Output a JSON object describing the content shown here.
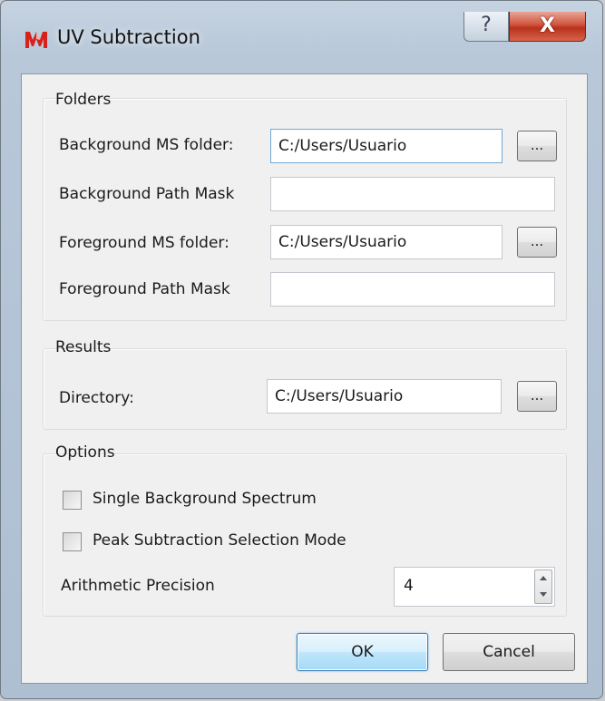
{
  "window": {
    "title": "UV Subtraction",
    "app_icon": "m-logo-icon",
    "help_label": "?",
    "close_label": "X"
  },
  "folders": {
    "title": "Folders",
    "background_ms_label": "Background MS folder:",
    "background_ms_value": "C:/Users/Usuario",
    "background_mask_label": "Background Path Mask",
    "background_mask_value": "",
    "foreground_ms_label": "Foreground MS folder:",
    "foreground_ms_value": "C:/Users/Usuario",
    "foreground_mask_label": "Foreground Path Mask",
    "foreground_mask_value": "",
    "browse_label": "..."
  },
  "results": {
    "title": "Results",
    "directory_label": "Directory:",
    "directory_value": "C:/Users/Usuario",
    "browse_label": "..."
  },
  "options": {
    "title": "Options",
    "single_background_label": "Single Background Spectrum",
    "single_background_checked": false,
    "peak_subtraction_label": "Peak Subtraction Selection Mode",
    "peak_subtraction_checked": false,
    "precision_label": "Arithmetic Precision",
    "precision_value": "4"
  },
  "buttons": {
    "ok_label": "OK",
    "cancel_label": "Cancel"
  },
  "colors": {
    "close_button": "#c94a34",
    "ok_button_accent": "#3c7fb1"
  }
}
